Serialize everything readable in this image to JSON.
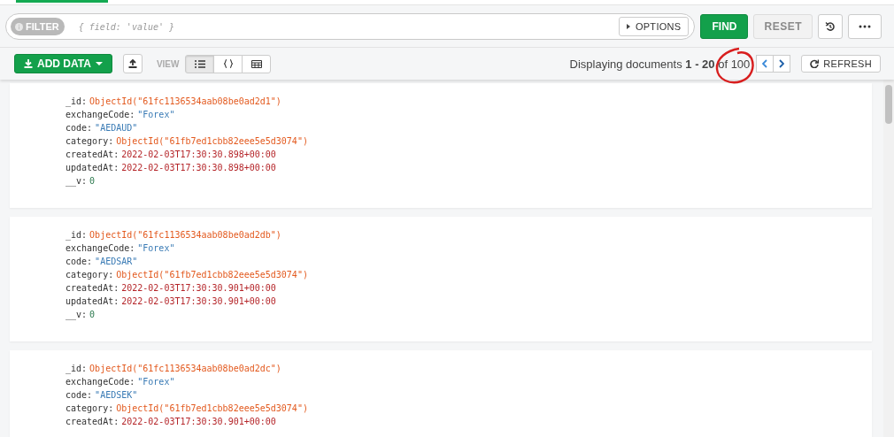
{
  "filter": {
    "label": "FILTER",
    "placeholder": "{ field: 'value' }",
    "options_label": "OPTIONS"
  },
  "query_buttons": {
    "find": "FIND",
    "reset": "RESET"
  },
  "toolbar": {
    "add_data": "ADD DATA",
    "view_label": "VIEW",
    "views": [
      {
        "kind": "list",
        "selected": true
      },
      {
        "kind": "json",
        "selected": false
      },
      {
        "kind": "table",
        "selected": false
      }
    ],
    "pagination": {
      "prefix": "Displaying documents",
      "range": "1 - 20",
      "suffix": "of 100"
    },
    "refresh": "REFRESH"
  },
  "documents": [
    {
      "fields": [
        {
          "key": "_id:",
          "value": "ObjectId(\"61fc1136534aab08be0ad2d1\")",
          "kind": "objectid"
        },
        {
          "key": "exchangeCode:",
          "value": "\"Forex\"",
          "kind": "string"
        },
        {
          "key": "code:",
          "value": "\"AEDAUD\"",
          "kind": "string"
        },
        {
          "key": "category:",
          "value": "ObjectId(\"61fb7ed1cbb82eee5e5d3074\")",
          "kind": "objectid"
        },
        {
          "key": "createdAt:",
          "value": "2022-02-03T17:30:30.898+00:00",
          "kind": "date"
        },
        {
          "key": "updatedAt:",
          "value": "2022-02-03T17:30:30.898+00:00",
          "kind": "date"
        },
        {
          "key": "__v:",
          "value": "0",
          "kind": "number"
        }
      ]
    },
    {
      "fields": [
        {
          "key": "_id:",
          "value": "ObjectId(\"61fc1136534aab08be0ad2db\")",
          "kind": "objectid"
        },
        {
          "key": "exchangeCode:",
          "value": "\"Forex\"",
          "kind": "string"
        },
        {
          "key": "code:",
          "value": "\"AEDSAR\"",
          "kind": "string"
        },
        {
          "key": "category:",
          "value": "ObjectId(\"61fb7ed1cbb82eee5e5d3074\")",
          "kind": "objectid"
        },
        {
          "key": "createdAt:",
          "value": "2022-02-03T17:30:30.901+00:00",
          "kind": "date"
        },
        {
          "key": "updatedAt:",
          "value": "2022-02-03T17:30:30.901+00:00",
          "kind": "date"
        },
        {
          "key": "__v:",
          "value": "0",
          "kind": "number"
        }
      ]
    },
    {
      "fields": [
        {
          "key": "_id:",
          "value": "ObjectId(\"61fc1136534aab08be0ad2dc\")",
          "kind": "objectid"
        },
        {
          "key": "exchangeCode:",
          "value": "\"Forex\"",
          "kind": "string"
        },
        {
          "key": "code:",
          "value": "\"AEDSEK\"",
          "kind": "string"
        },
        {
          "key": "category:",
          "value": "ObjectId(\"61fb7ed1cbb82eee5e5d3074\")",
          "kind": "objectid"
        },
        {
          "key": "createdAt:",
          "value": "2022-02-03T17:30:30.901+00:00",
          "kind": "date"
        }
      ]
    }
  ]
}
